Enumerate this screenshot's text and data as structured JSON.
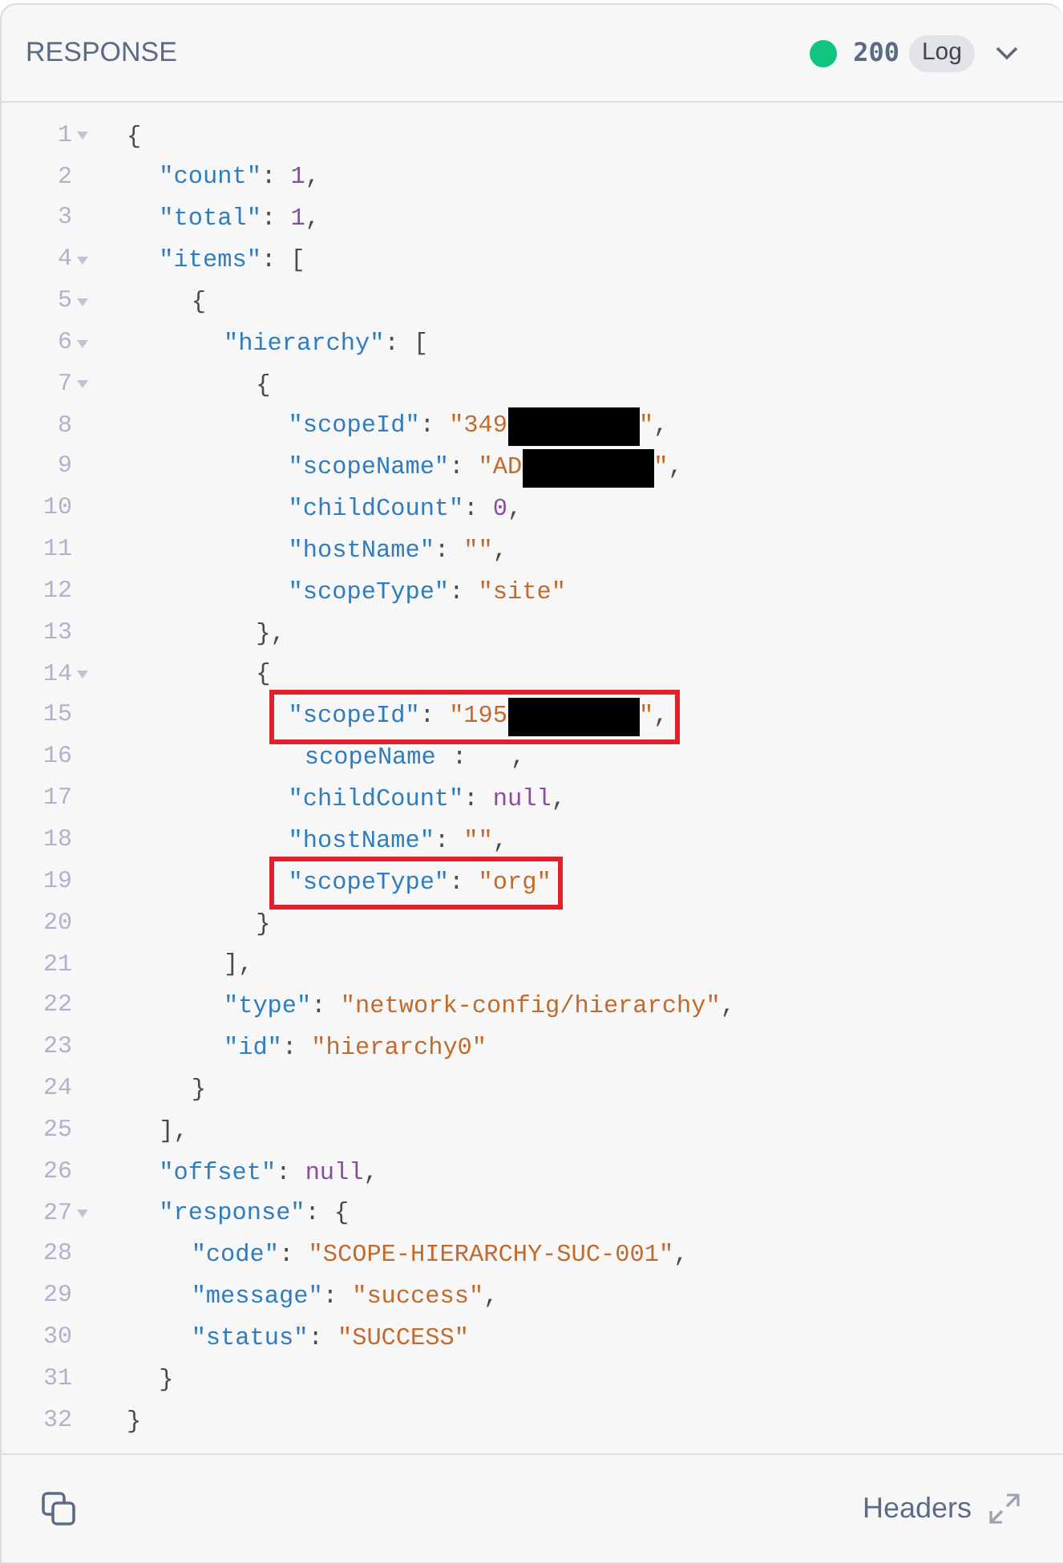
{
  "header": {
    "title": "RESPONSE",
    "status_dot": {
      "color": "#10c47f"
    },
    "status_code": "200",
    "log_label": "Log"
  },
  "lines": [
    {
      "number": "1",
      "foldable": true,
      "tokens": [
        {
          "kind": "punct",
          "text": "{"
        }
      ]
    },
    {
      "number": "2",
      "foldable": false,
      "tokens": [
        {
          "kind": "key",
          "text": "  \"count\""
        },
        {
          "kind": "punct",
          "text": ": "
        },
        {
          "kind": "number",
          "text": "1"
        },
        {
          "kind": "punct",
          "text": ","
        }
      ]
    },
    {
      "number": "3",
      "foldable": false,
      "tokens": [
        {
          "kind": "key",
          "text": "  \"total\""
        },
        {
          "kind": "punct",
          "text": ": "
        },
        {
          "kind": "number",
          "text": "1"
        },
        {
          "kind": "punct",
          "text": ","
        }
      ]
    },
    {
      "number": "4",
      "foldable": true,
      "tokens": [
        {
          "kind": "key",
          "text": "  \"items\""
        },
        {
          "kind": "punct",
          "text": ": ["
        }
      ]
    },
    {
      "number": "5",
      "foldable": true,
      "tokens": [
        {
          "kind": "punct",
          "text": "    {"
        }
      ]
    },
    {
      "number": "6",
      "foldable": true,
      "tokens": [
        {
          "kind": "key",
          "text": "      \"hierarchy\""
        },
        {
          "kind": "punct",
          "text": ": ["
        }
      ]
    },
    {
      "number": "7",
      "foldable": true,
      "tokens": [
        {
          "kind": "punct",
          "text": "        {"
        }
      ]
    },
    {
      "number": "8",
      "foldable": false,
      "tokens": [
        {
          "kind": "key",
          "text": "          \"scopeId\""
        },
        {
          "kind": "punct",
          "text": ": "
        },
        {
          "kind": "string",
          "text": "\"349"
        },
        {
          "kind": "redacted"
        },
        {
          "kind": "string",
          "text": "\""
        },
        {
          "kind": "punct",
          "text": ","
        }
      ]
    },
    {
      "number": "9",
      "foldable": false,
      "tokens": [
        {
          "kind": "key",
          "text": "          \"scopeName\""
        },
        {
          "kind": "punct",
          "text": ": "
        },
        {
          "kind": "string",
          "text": "\"AD"
        },
        {
          "kind": "redacted"
        },
        {
          "kind": "string",
          "text": "\""
        },
        {
          "kind": "punct",
          "text": ","
        }
      ]
    },
    {
      "number": "10",
      "foldable": false,
      "tokens": [
        {
          "kind": "key",
          "text": "          \"childCount\""
        },
        {
          "kind": "punct",
          "text": ": "
        },
        {
          "kind": "number",
          "text": "0"
        },
        {
          "kind": "punct",
          "text": ","
        }
      ]
    },
    {
      "number": "11",
      "foldable": false,
      "tokens": [
        {
          "kind": "key",
          "text": "          \"hostName\""
        },
        {
          "kind": "punct",
          "text": ": "
        },
        {
          "kind": "string",
          "text": "\"\""
        },
        {
          "kind": "punct",
          "text": ","
        }
      ]
    },
    {
      "number": "12",
      "foldable": false,
      "tokens": [
        {
          "kind": "key",
          "text": "          \"scopeType\""
        },
        {
          "kind": "punct",
          "text": ": "
        },
        {
          "kind": "string",
          "text": "\"site\""
        }
      ]
    },
    {
      "number": "13",
      "foldable": false,
      "tokens": [
        {
          "kind": "punct",
          "text": "        },"
        }
      ]
    },
    {
      "number": "14",
      "foldable": true,
      "tokens": [
        {
          "kind": "punct",
          "text": "        {"
        }
      ]
    },
    {
      "number": "15",
      "foldable": false,
      "highlighted": true,
      "tokens": [
        {
          "kind": "key",
          "text": "          \"scopeId\""
        },
        {
          "kind": "punct",
          "text": ": "
        },
        {
          "kind": "string",
          "text": "\"195"
        },
        {
          "kind": "redacted"
        },
        {
          "kind": "string",
          "text": "\""
        },
        {
          "kind": "punct",
          "text": ","
        }
      ]
    },
    {
      "number": "16",
      "foldable": false,
      "tokens": [
        {
          "kind": "key",
          "text": "           scopeName"
        },
        {
          "kind": "punct",
          "text": " :   ,"
        }
      ]
    },
    {
      "number": "17",
      "foldable": false,
      "tokens": [
        {
          "kind": "key",
          "text": "          \"childCount\""
        },
        {
          "kind": "punct",
          "text": ": "
        },
        {
          "kind": "number",
          "text": "null"
        },
        {
          "kind": "punct",
          "text": ","
        }
      ]
    },
    {
      "number": "18",
      "foldable": false,
      "tokens": [
        {
          "kind": "key",
          "text": "          \"hostName\""
        },
        {
          "kind": "punct",
          "text": ": "
        },
        {
          "kind": "string",
          "text": "\"\""
        },
        {
          "kind": "punct",
          "text": ","
        }
      ]
    },
    {
      "number": "19",
      "foldable": false,
      "highlighted": true,
      "tokens": [
        {
          "kind": "key",
          "text": "          \"scopeType\""
        },
        {
          "kind": "punct",
          "text": ": "
        },
        {
          "kind": "string",
          "text": "\"org\""
        }
      ]
    },
    {
      "number": "20",
      "foldable": false,
      "tokens": [
        {
          "kind": "punct",
          "text": "        }"
        }
      ]
    },
    {
      "number": "21",
      "foldable": false,
      "tokens": [
        {
          "kind": "punct",
          "text": "      ],"
        }
      ]
    },
    {
      "number": "22",
      "foldable": false,
      "tokens": [
        {
          "kind": "key",
          "text": "      \"type\""
        },
        {
          "kind": "punct",
          "text": ": "
        },
        {
          "kind": "string",
          "text": "\"network-config/hierarchy\""
        },
        {
          "kind": "punct",
          "text": ","
        }
      ]
    },
    {
      "number": "23",
      "foldable": false,
      "tokens": [
        {
          "kind": "key",
          "text": "      \"id\""
        },
        {
          "kind": "punct",
          "text": ": "
        },
        {
          "kind": "string",
          "text": "\"hierarchy0\""
        }
      ]
    },
    {
      "number": "24",
      "foldable": false,
      "tokens": [
        {
          "kind": "punct",
          "text": "    }"
        }
      ]
    },
    {
      "number": "25",
      "foldable": false,
      "tokens": [
        {
          "kind": "punct",
          "text": "  ],"
        }
      ]
    },
    {
      "number": "26",
      "foldable": false,
      "tokens": [
        {
          "kind": "key",
          "text": "  \"offset\""
        },
        {
          "kind": "punct",
          "text": ": "
        },
        {
          "kind": "number",
          "text": "null"
        },
        {
          "kind": "punct",
          "text": ","
        }
      ]
    },
    {
      "number": "27",
      "foldable": true,
      "tokens": [
        {
          "kind": "key",
          "text": "  \"response\""
        },
        {
          "kind": "punct",
          "text": ": {"
        }
      ]
    },
    {
      "number": "28",
      "foldable": false,
      "tokens": [
        {
          "kind": "key",
          "text": "    \"code\""
        },
        {
          "kind": "punct",
          "text": ": "
        },
        {
          "kind": "string",
          "text": "\"SCOPE-HIERARCHY-SUC-001\""
        },
        {
          "kind": "punct",
          "text": ","
        }
      ]
    },
    {
      "number": "29",
      "foldable": false,
      "tokens": [
        {
          "kind": "key",
          "text": "    \"message\""
        },
        {
          "kind": "punct",
          "text": ": "
        },
        {
          "kind": "string",
          "text": "\"success\""
        },
        {
          "kind": "punct",
          "text": ","
        }
      ]
    },
    {
      "number": "30",
      "foldable": false,
      "tokens": [
        {
          "kind": "key",
          "text": "    \"status\""
        },
        {
          "kind": "punct",
          "text": ": "
        },
        {
          "kind": "string",
          "text": "\"SUCCESS\""
        }
      ]
    },
    {
      "number": "31",
      "foldable": false,
      "tokens": [
        {
          "kind": "punct",
          "text": "  }"
        }
      ]
    },
    {
      "number": "32",
      "foldable": false,
      "tokens": [
        {
          "kind": "punct",
          "text": "}"
        }
      ]
    }
  ],
  "footer": {
    "headers_label": "Headers"
  }
}
